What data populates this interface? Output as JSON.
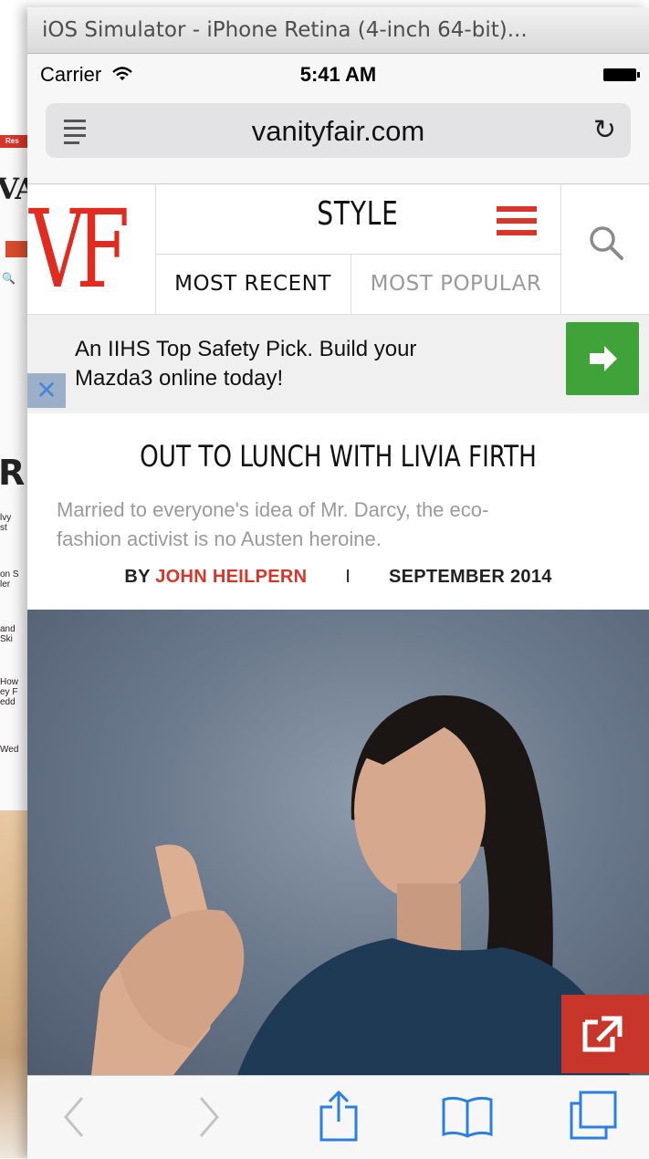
{
  "window": {
    "title": "iOS Simulator - iPhone Retina (4-inch 64-bit)..."
  },
  "status_bar": {
    "carrier": "Carrier",
    "time": "5:41 AM"
  },
  "address_bar": {
    "url": "vanityfair.com"
  },
  "site_header": {
    "logo": "VF",
    "section": "STYLE",
    "tabs": [
      {
        "label": "MOST RECENT",
        "active": true
      },
      {
        "label": "MOST POPULAR",
        "active": false
      }
    ]
  },
  "ad": {
    "text_line1": "An IIHS Top Safety Pick. Build your",
    "text_line2": "Mazda3 online today!",
    "button_color": "#3fa33a"
  },
  "article": {
    "headline": "OUT TO LUNCH WITH LIVIA FIRTH",
    "dek_line1": "Married to everyone's idea of Mr. Darcy, the eco-",
    "dek_line2": "fashion activist is no Austen heroine.",
    "by_prefix": "BY",
    "author": "JOHN HEILPERN",
    "separator": "I",
    "date": "SEPTEMBER 2014"
  },
  "background_window": {
    "banner": "Res",
    "lines": [
      "lvy ",
      "st",
      "on S",
      "ler",
      "and",
      " Ski",
      "How",
      "ey F",
      "edd",
      "Wed"
    ],
    "large_letter": "R"
  },
  "colors": {
    "accent": "#d8362b",
    "ad_green": "#3fa33a"
  }
}
